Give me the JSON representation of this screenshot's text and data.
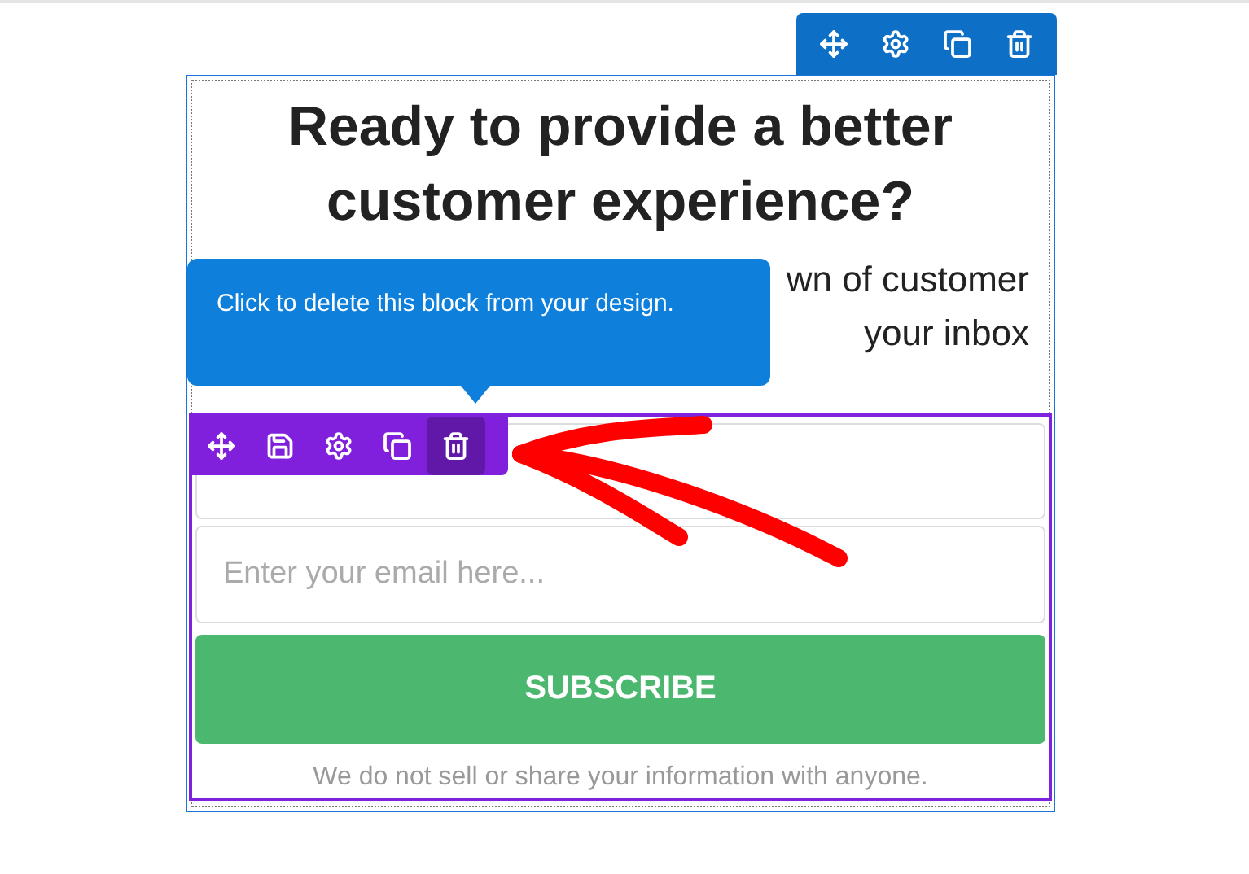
{
  "block_toolbar": {
    "buttons": [
      {
        "kind": "move"
      },
      {
        "kind": "settings"
      },
      {
        "kind": "copy"
      },
      {
        "kind": "delete"
      }
    ]
  },
  "heading": "Ready to provide a better customer experience?",
  "paragraph_lines": [
    "wn of customer",
    "your inbox"
  ],
  "tooltip": "Click to delete this block from your design.",
  "form_toolbar": {
    "buttons": [
      {
        "kind": "move",
        "selected": false
      },
      {
        "kind": "save",
        "selected": false
      },
      {
        "kind": "settings",
        "selected": false
      },
      {
        "kind": "copy",
        "selected": false
      },
      {
        "kind": "delete",
        "selected": true
      }
    ]
  },
  "email_field": {
    "placeholder": "Enter your email here..."
  },
  "subscribe_button": "SUBSCRIBE",
  "disclaimer": "We do not sell or share your information with anyone."
}
